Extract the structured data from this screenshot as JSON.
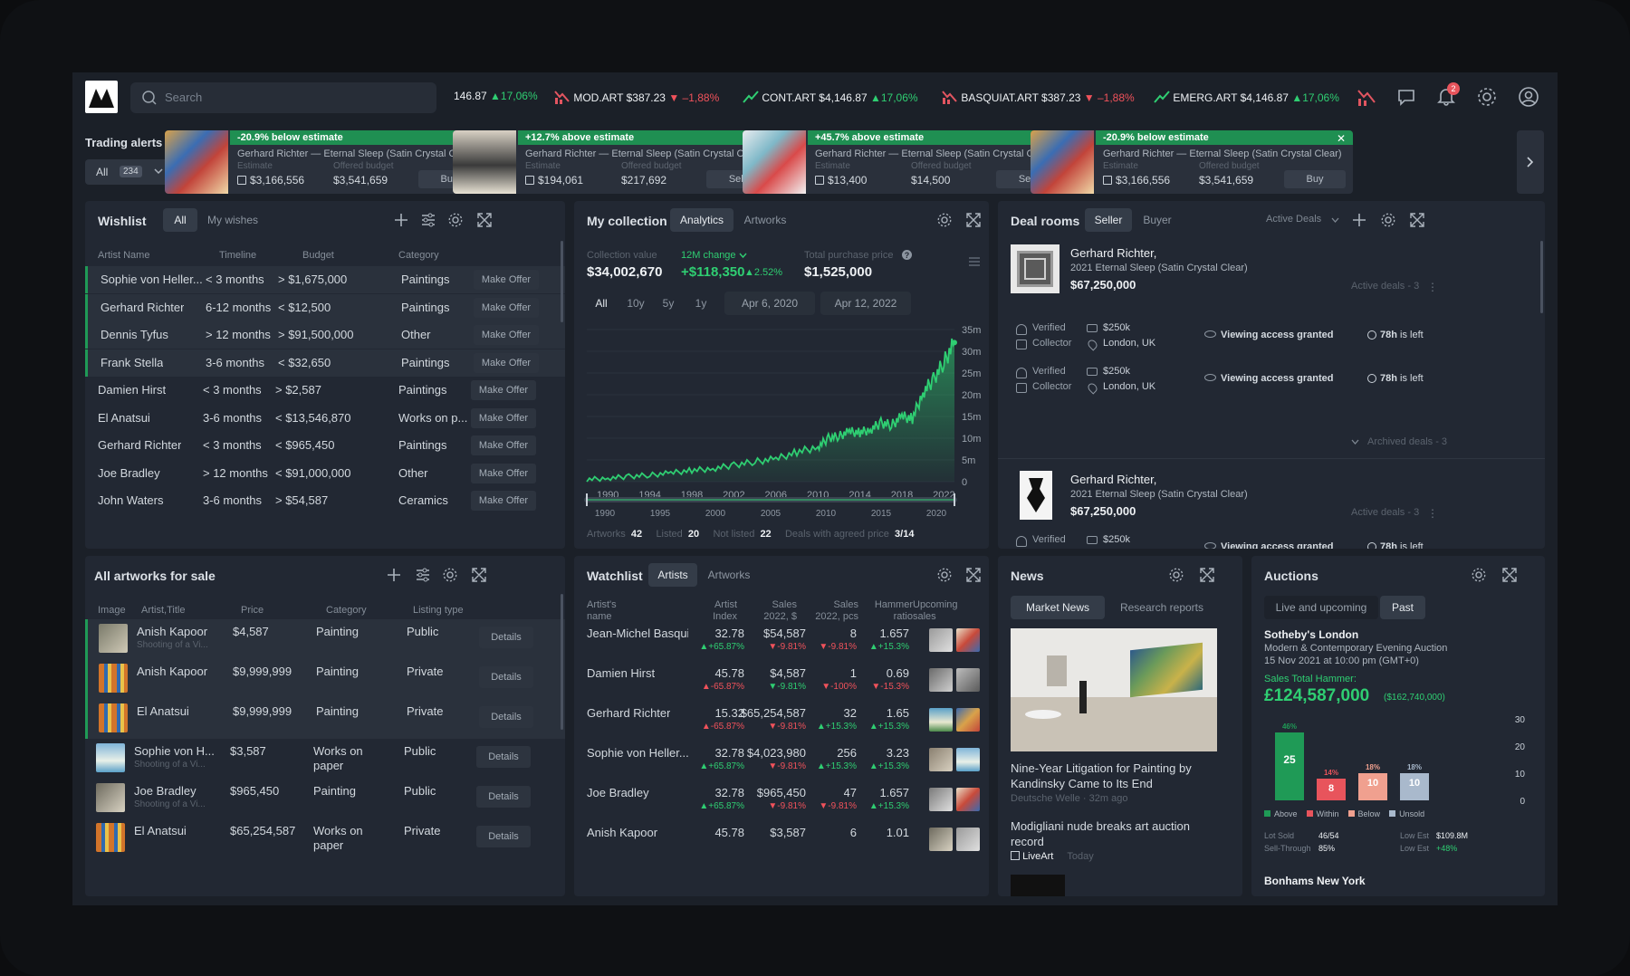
{
  "topbar": {
    "search_placeholder": "Search",
    "tickers": [
      {
        "name": "",
        "price": "146.87",
        "change": "▲17,06%",
        "dir": "up"
      },
      {
        "name": "MOD.ART",
        "price": "$387.23",
        "change": "▼ –1,88%",
        "dir": "down"
      },
      {
        "name": "CONT.ART",
        "price": "$4,146.87",
        "change": "▲17,06%",
        "dir": "up"
      },
      {
        "name": "BASQUIAT.ART",
        "price": "$387.23",
        "change": "▼ –1,88%",
        "dir": "down"
      },
      {
        "name": "EMERG.ART",
        "price": "$4,146.87",
        "change": "▲17,06%",
        "dir": "up"
      }
    ],
    "notification_count": "2"
  },
  "trading_alerts": {
    "title": "Trading alerts",
    "filter_label": "All",
    "filter_count": "234",
    "estimate_label": "Estimate",
    "budget_label": "Offered budget",
    "items": [
      {
        "header": "-20.9% below estimate",
        "kind": "below",
        "title": "Gerhard Richter — Eternal Sleep (Satin Crystal Clear)",
        "estimate": "$3,166,556",
        "budget": "$3,541,659",
        "action": "Buy"
      },
      {
        "header": "+12.7% above estimate",
        "kind": "above",
        "title": "Gerhard Richter — Eternal Sleep (Satin Crystal Clear)",
        "estimate": "$194,061",
        "budget": "$217,692",
        "action": "Sell"
      },
      {
        "header": "+45.7% above estimate",
        "kind": "above",
        "title": "Gerhard Richter — Eternal Sleep (Satin Crystal Clear)",
        "estimate": "$13,400",
        "budget": "$14,500",
        "action": "Sell"
      },
      {
        "header": "-20.9% below estimate",
        "kind": "below",
        "title": "Gerhard Richter — Eternal Sleep (Satin Crystal Clear)",
        "estimate": "$3,166,556",
        "budget": "$3,541,659",
        "action": "Buy"
      }
    ]
  },
  "wishlist": {
    "title": "Wishlist",
    "tabs": [
      "All",
      "My wishes"
    ],
    "columns": [
      "Artist Name",
      "Timeline",
      "Budget",
      "Category"
    ],
    "action_label": "Make Offer",
    "rows": [
      {
        "artist": "Sophie von Heller...",
        "timeline": "< 3 months",
        "budget": "> $1,675,000",
        "category": "Paintings",
        "highlight": true
      },
      {
        "artist": "Gerhard Richter",
        "timeline": "6-12 months",
        "budget": "< $12,500",
        "category": "Paintings",
        "highlight": true
      },
      {
        "artist": "Dennis Tyfus",
        "timeline": "> 12 months",
        "budget": "> $91,500,000",
        "category": "Other",
        "highlight": true
      },
      {
        "artist": "Frank Stella",
        "timeline": "3-6 months",
        "budget": "< $32,650",
        "category": "Paintings",
        "highlight": true
      },
      {
        "artist": "Damien Hirst",
        "timeline": "< 3 months",
        "budget": "> $2,587",
        "category": "Paintings",
        "highlight": false
      },
      {
        "artist": "El Anatsui",
        "timeline": "3-6 months",
        "budget": "< $13,546,870",
        "category": "Works on p...",
        "highlight": false
      },
      {
        "artist": "Gerhard Richter",
        "timeline": "< 3 months",
        "budget": "< $965,450",
        "category": "Paintings",
        "highlight": false
      },
      {
        "artist": "Joe Bradley",
        "timeline": "> 12 months",
        "budget": "< $91,000,000",
        "category": "Other",
        "highlight": false
      },
      {
        "artist": "John Waters",
        "timeline": "3-6 months",
        "budget": "> $54,587",
        "category": "Ceramics",
        "highlight": false
      }
    ]
  },
  "collection": {
    "title": "My collection",
    "tabs": [
      "Analytics",
      "Artworks"
    ],
    "value_label": "Collection value",
    "value": "$34,002,670",
    "change_label": "12M change",
    "change_value": "+$118,350",
    "change_pct": "▲2.52%",
    "purchase_label": "Total purchase price",
    "purchase_value": "$1,525,000",
    "ranges": [
      "All",
      "10y",
      "5y",
      "1y"
    ],
    "date_from": "Apr 6, 2020",
    "date_to": "Apr 12, 2022",
    "stats": [
      {
        "label": "Artworks",
        "value": "42"
      },
      {
        "label": "Listed",
        "value": "20"
      },
      {
        "label": "Not listed",
        "value": "22"
      },
      {
        "label": "Deals with agreed price",
        "value": "3/14"
      }
    ]
  },
  "chart_data": {
    "type": "area",
    "title": "",
    "xlabel": "",
    "ylabel": "",
    "x_ticks": [
      "1990",
      "1994",
      "1998",
      "2002",
      "2006",
      "2010",
      "2014",
      "2018",
      "2022"
    ],
    "y_ticks": [
      "0",
      "5m",
      "10m",
      "15m",
      "20m",
      "25m",
      "30m",
      "35m"
    ],
    "ylim": [
      0,
      35
    ],
    "brush_ticks": [
      "1990",
      "1995",
      "2000",
      "2005",
      "2010",
      "2015",
      "2020"
    ],
    "series": [
      {
        "x": [
          1988,
          1990,
          1992,
          1994,
          1996,
          1998,
          2000,
          2002,
          2004,
          2006,
          2008,
          2010,
          2011,
          2012,
          2013,
          2014,
          2015,
          2016,
          2017,
          2018,
          2019,
          2020,
          2021,
          2022,
          2023
        ],
        "y": [
          0.5,
          0.8,
          1.2,
          1.5,
          2.0,
          2.6,
          3.0,
          3.8,
          4.6,
          5.2,
          6.8,
          8.0,
          10.0,
          10.5,
          11.5,
          11.3,
          12.0,
          13.5,
          13.0,
          15.0,
          14.5,
          20.5,
          23.5,
          27.5,
          32.0
        ]
      }
    ],
    "color": "#2fce72"
  },
  "deal_rooms": {
    "title": "Deal rooms",
    "tabs": [
      "Seller",
      "Buyer"
    ],
    "filter": "Active Deals",
    "deals": [
      {
        "artist": "Gerhard Richter,",
        "year": "2021",
        "work": "Eternal Sleep (Satin Crystal Clear)",
        "price": "$67,250,000",
        "active": "Active deals - 3",
        "buyers": [
          {
            "verified": "Verified",
            "budget": "$250k",
            "role": "Collector",
            "location": "London, UK",
            "access": "Viewing access granted",
            "time": "78h",
            "time_suffix": "is left"
          },
          {
            "verified": "Verified",
            "budget": "$250k",
            "role": "Collector",
            "location": "London, UK",
            "access": "Viewing access granted",
            "time": "78h",
            "time_suffix": "is left"
          }
        ],
        "archived": "Archived deals - 3"
      },
      {
        "artist": "Gerhard Richter,",
        "year": "2021",
        "work": "Eternal Sleep (Satin Crystal Clear)",
        "price": "$67,250,000",
        "active": "Active deals - 3",
        "buyers": [
          {
            "verified": "Verified",
            "budget": "$250k",
            "role": "",
            "location": "",
            "access": "Viewing access granted",
            "time": "78h",
            "time_suffix": "is left"
          }
        ]
      }
    ]
  },
  "artworks_sale": {
    "title": "All artworks for sale",
    "columns": [
      "Image",
      "Artist,Title",
      "Price",
      "Category",
      "Listing type"
    ],
    "action_label": "Details",
    "rows": [
      {
        "artist": "Anish Kapoor",
        "title": "Shooting of a Vi...",
        "price": "$4,587",
        "category": "Painting",
        "category2": "",
        "listing": "Public",
        "highlight": true
      },
      {
        "artist": "Anish Kapoor",
        "title": "",
        "price": "$9,999,999",
        "category": "Painting",
        "category2": "",
        "listing": "Private",
        "highlight": true
      },
      {
        "artist": "El Anatsui",
        "title": "",
        "price": "$9,999,999",
        "category": "Painting",
        "category2": "",
        "listing": "Private",
        "highlight": true
      },
      {
        "artist": "Sophie von H...",
        "title": "Shooting of a Vi...",
        "price": "$3,587",
        "category": "Works on",
        "category2": "paper",
        "listing": "Public",
        "highlight": false
      },
      {
        "artist": "Joe Bradley",
        "title": "Shooting of a Vi...",
        "price": "$965,450",
        "category": "Painting",
        "category2": "",
        "listing": "Public",
        "highlight": false
      },
      {
        "artist": "El Anatsui",
        "title": "",
        "price": "$65,254,587",
        "category": "Works on",
        "category2": "paper",
        "listing": "Private",
        "highlight": false
      }
    ]
  },
  "watchlist": {
    "title": "Watchlist",
    "tabs": [
      "Artists",
      "Artworks"
    ],
    "columns": [
      {
        "l1": "Artist's",
        "l2": "name"
      },
      {
        "l1": "Artist",
        "l2": "Index"
      },
      {
        "l1": "Sales",
        "l2": "2022, $"
      },
      {
        "l1": "Sales",
        "l2": "2022, pcs"
      },
      {
        "l1": "Hammer",
        "l2": "ratio"
      },
      {
        "l1": "Upcoming",
        "l2": "sales"
      }
    ],
    "rows": [
      {
        "name": "Jean-Michel Basqui...",
        "index": "32.78",
        "index_ch": "▲+65.87%",
        "index_dir": "up",
        "sales": "$54,587",
        "sales_ch": "▼-9.81%",
        "sales_dir": "down",
        "pcs": "8",
        "pcs_ch": "▼-9.81%",
        "pcs_dir": "down",
        "ratio": "1.657",
        "ratio_ch": "▲+15.3%",
        "ratio_dir": "up"
      },
      {
        "name": "Damien Hirst",
        "index": "45.78",
        "index_ch": "▲-65.87%",
        "index_dir": "down",
        "sales": "$4,587",
        "sales_ch": "▼-9.81%",
        "sales_dir": "up",
        "pcs": "1",
        "pcs_ch": "▼-100%",
        "pcs_dir": "down",
        "ratio": "0.69",
        "ratio_ch": "▼-15.3%",
        "ratio_dir": "down"
      },
      {
        "name": "Gerhard Richter",
        "index": "15.32",
        "index_ch": "▲-65.87%",
        "index_dir": "down",
        "sales": "$65,254,587",
        "sales_ch": "▼-9.81%",
        "sales_dir": "down",
        "pcs": "32",
        "pcs_ch": "▲+15.3%",
        "pcs_dir": "up",
        "ratio": "1.65",
        "ratio_ch": "▲+15.3%",
        "ratio_dir": "up"
      },
      {
        "name": "Sophie von Heller...",
        "index": "32.78",
        "index_ch": "▲+65.87%",
        "index_dir": "up",
        "sales": "$4,023,980",
        "sales_ch": "▼-9.81%",
        "sales_dir": "down",
        "pcs": "256",
        "pcs_ch": "▲+15.3%",
        "pcs_dir": "up",
        "ratio": "3.23",
        "ratio_ch": "▲+15.3%",
        "ratio_dir": "up"
      },
      {
        "name": "Joe Bradley",
        "index": "32.78",
        "index_ch": "▲+65.87%",
        "index_dir": "up",
        "sales": "$965,450",
        "sales_ch": "▼-9.81%",
        "sales_dir": "down",
        "pcs": "47",
        "pcs_ch": "▼-9.81%",
        "pcs_dir": "down",
        "ratio": "1.657",
        "ratio_ch": "▲+15.3%",
        "ratio_dir": "up"
      },
      {
        "name": "Anish Kapoor",
        "index": "45.78",
        "index_ch": "",
        "index_dir": "down",
        "sales": "$3,587",
        "sales_ch": "",
        "sales_dir": "down",
        "pcs": "6",
        "pcs_ch": "",
        "pcs_dir": "down",
        "ratio": "1.01",
        "ratio_ch": "",
        "ratio_dir": "up"
      }
    ]
  },
  "news": {
    "title": "News",
    "tabs": [
      "Market News",
      "Research reports"
    ],
    "items": [
      {
        "headline": "Nine-Year Litigation for Painting by Kandinsky Came to Its End",
        "source": "Deutsche Welle",
        "time": "32m ago"
      },
      {
        "headline": "Modigliani nude breaks art auction record",
        "source": "LiveArt",
        "time": "Today"
      }
    ]
  },
  "auctions": {
    "title": "Auctions",
    "tabs": [
      "Live and upcoming",
      "Past"
    ],
    "house": "Sotheby's London",
    "event": "Modern & Contemporary Evening Auction",
    "datetime": "15 Nov 2021 at 10:00 pm (GMT+0)",
    "hammer_label": "Sales Total Hammer:",
    "hammer_value": "£124,587,000",
    "hammer_sub": "($162,740,000)",
    "bars": [
      {
        "label": "Above",
        "value": 25,
        "pct": "46%",
        "color": "#1f9a56"
      },
      {
        "label": "Within",
        "value": 8,
        "pct": "14%",
        "color": "#e8545c"
      },
      {
        "label": "Below",
        "value": 10,
        "pct": "18%",
        "color": "#f0a08f"
      },
      {
        "label": "Unsold",
        "value": 10,
        "pct": "18%",
        "color": "#a9b9cc"
      }
    ],
    "y_ticks": [
      "0",
      "10",
      "20",
      "30"
    ],
    "ymax": 30,
    "stats": [
      {
        "label": "Lot Sold",
        "value": "46/54",
        "label2": "Low Est",
        "value2": "$109.8M"
      },
      {
        "label": "Sell-Through",
        "value": "85%",
        "label2": "Low Est",
        "value2": "+48%"
      }
    ],
    "next_house": "Bonhams New York"
  }
}
